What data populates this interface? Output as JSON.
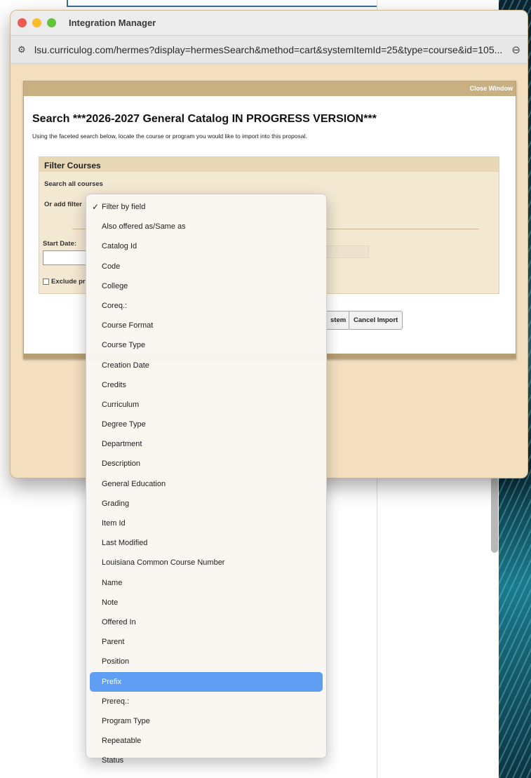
{
  "window": {
    "title": "Integration Manager",
    "url": "lsu.curriculog.com/hermes?display=hermesSearch&method=cart&systemItemId=25&type=course&id=105..."
  },
  "panel": {
    "close_label": "Close Window",
    "title": "Search ***2026-2027 General Catalog IN PROGRESS VERSION***",
    "description": "Using the faceted search below, locate the course or program you would like to import into this proposal."
  },
  "filter": {
    "heading": "Filter Courses",
    "search_all": "Search all courses",
    "or_add_filter": "Or add filter",
    "start_date_label": "Start Date:",
    "exclude_label": "Exclude pr",
    "system_button": "stem",
    "cancel_button": "Cancel Import"
  },
  "dropdown": {
    "items": [
      {
        "label": "Filter by field",
        "checked": true
      },
      {
        "label": "Also offered as/Same as"
      },
      {
        "label": "Catalog Id"
      },
      {
        "label": "Code"
      },
      {
        "label": "College"
      },
      {
        "label": "Coreq.:"
      },
      {
        "label": "Course Format"
      },
      {
        "label": "Course Type"
      },
      {
        "label": "Creation Date"
      },
      {
        "label": "Credits"
      },
      {
        "label": "Curriculum"
      },
      {
        "label": "Degree Type"
      },
      {
        "label": "Department"
      },
      {
        "label": "Description"
      },
      {
        "label": "General Education"
      },
      {
        "label": "Grading"
      },
      {
        "label": "Item Id"
      },
      {
        "label": "Last Modified"
      },
      {
        "label": "Louisiana Common Course Number"
      },
      {
        "label": "Name"
      },
      {
        "label": "Note"
      },
      {
        "label": "Offered In"
      },
      {
        "label": "Parent"
      },
      {
        "label": "Position"
      },
      {
        "label": "Prefix",
        "highlighted": true
      },
      {
        "label": "Prereq.:"
      },
      {
        "label": "Program Type"
      },
      {
        "label": "Repeatable"
      },
      {
        "label": "Status"
      }
    ]
  },
  "colors": {
    "window_bg": "#f3dfbe",
    "panel_header": "#c9b082",
    "highlight": "#5f9ef2"
  }
}
